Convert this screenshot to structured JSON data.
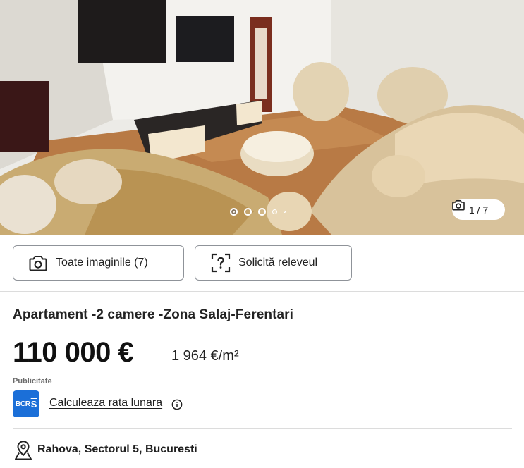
{
  "gallery": {
    "photo_alt": "",
    "counter": "1 / 7",
    "dots": 5,
    "active_dot": 0
  },
  "buttons": {
    "all_images": "Toate imaginile (7)",
    "request_survey": "Solicită releveul"
  },
  "listing": {
    "title": "Apartament -2 camere -Zona Salaj-Ferentari",
    "price": "110 000 €",
    "price_per_sqm": "1 964 €/m²",
    "ad_label": "Publicitate",
    "bank_logo_text": "BCR",
    "bank_logo_symbol": "S",
    "calculate_link": "Calculeaza rata lunara",
    "location": "Rahova, Sectorul 5, Bucuresti"
  },
  "colors": {
    "bank_blue": "#1b6fd8",
    "border": "#8f9399",
    "text": "#1f1f1f"
  },
  "icons": {
    "counter": "camera-icon",
    "all_images": "camera-icon",
    "request_survey": "floorplan-scan-icon",
    "info": "info-icon",
    "location": "map-pin-icon"
  }
}
